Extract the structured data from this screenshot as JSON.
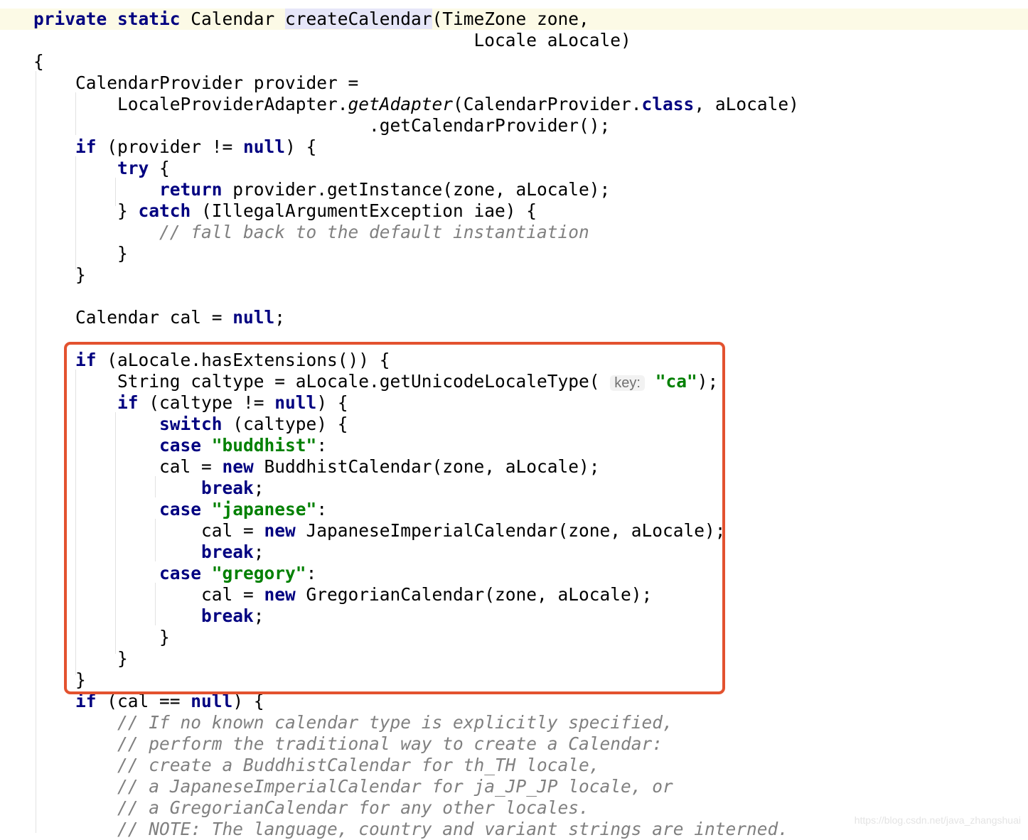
{
  "editor": {
    "language": "java",
    "lines": [
      [
        {
          "t": "private static",
          "c": "kw"
        },
        {
          "t": " Calendar "
        },
        {
          "t": "createCalendar",
          "c": "mhl"
        },
        {
          "t": "(TimeZone zone,"
        }
      ],
      [
        {
          "t": "                                          Locale aLocale)"
        }
      ],
      [
        {
          "t": "{"
        }
      ],
      [
        {
          "t": "    CalendarProvider provider ="
        }
      ],
      [
        {
          "t": "        LocaleProviderAdapter."
        },
        {
          "t": "getAdapter",
          "c": "it"
        },
        {
          "t": "(CalendarProvider."
        },
        {
          "t": "class",
          "c": "kw"
        },
        {
          "t": ", aLocale)"
        }
      ],
      [
        {
          "t": "                                .getCalendarProvider();"
        }
      ],
      [
        {
          "t": "    "
        },
        {
          "t": "if",
          "c": "kw"
        },
        {
          "t": " (provider != "
        },
        {
          "t": "null",
          "c": "kw"
        },
        {
          "t": ") {"
        }
      ],
      [
        {
          "t": "        "
        },
        {
          "t": "try",
          "c": "kw"
        },
        {
          "t": " {"
        }
      ],
      [
        {
          "t": "            "
        },
        {
          "t": "return",
          "c": "kw"
        },
        {
          "t": " provider.getInstance(zone, aLocale);"
        }
      ],
      [
        {
          "t": "        } "
        },
        {
          "t": "catch",
          "c": "kw"
        },
        {
          "t": " (IllegalArgumentException iae) {"
        }
      ],
      [
        {
          "t": "            "
        },
        {
          "t": "// fall back to the default instantiation",
          "c": "cm"
        }
      ],
      [
        {
          "t": "        }"
        }
      ],
      [
        {
          "t": "    }"
        }
      ],
      [
        {
          "t": ""
        }
      ],
      [
        {
          "t": "    Calendar cal = "
        },
        {
          "t": "null",
          "c": "kw"
        },
        {
          "t": ";"
        }
      ],
      [
        {
          "t": ""
        }
      ],
      [
        {
          "t": "    "
        },
        {
          "t": "if",
          "c": "kw"
        },
        {
          "t": " (aLocale.hasExtensions()) {"
        }
      ],
      [
        {
          "t": "        String caltype = aLocale.getUnicodeLocaleType( "
        },
        {
          "t": "key:",
          "c": "hint"
        },
        {
          "t": " "
        },
        {
          "t": "\"ca\"",
          "c": "str"
        },
        {
          "t": ");"
        }
      ],
      [
        {
          "t": "        "
        },
        {
          "t": "if",
          "c": "kw"
        },
        {
          "t": " (caltype != "
        },
        {
          "t": "null",
          "c": "kw"
        },
        {
          "t": ") {"
        }
      ],
      [
        {
          "t": "            "
        },
        {
          "t": "switch",
          "c": "kw"
        },
        {
          "t": " (caltype) {"
        }
      ],
      [
        {
          "t": "            "
        },
        {
          "t": "case",
          "c": "kw"
        },
        {
          "t": " "
        },
        {
          "t": "\"buddhist\"",
          "c": "str"
        },
        {
          "t": ":"
        }
      ],
      [
        {
          "t": "            cal = "
        },
        {
          "t": "new",
          "c": "kw"
        },
        {
          "t": " BuddhistCalendar(zone, aLocale);"
        }
      ],
      [
        {
          "t": "                "
        },
        {
          "t": "break",
          "c": "kw"
        },
        {
          "t": ";"
        }
      ],
      [
        {
          "t": "            "
        },
        {
          "t": "case",
          "c": "kw"
        },
        {
          "t": " "
        },
        {
          "t": "\"japanese\"",
          "c": "str"
        },
        {
          "t": ":"
        }
      ],
      [
        {
          "t": "                cal = "
        },
        {
          "t": "new",
          "c": "kw"
        },
        {
          "t": " JapaneseImperialCalendar(zone, aLocale);"
        }
      ],
      [
        {
          "t": "                "
        },
        {
          "t": "break",
          "c": "kw"
        },
        {
          "t": ";"
        }
      ],
      [
        {
          "t": "            "
        },
        {
          "t": "case",
          "c": "kw"
        },
        {
          "t": " "
        },
        {
          "t": "\"gregory\"",
          "c": "str"
        },
        {
          "t": ":"
        }
      ],
      [
        {
          "t": "                cal = "
        },
        {
          "t": "new",
          "c": "kw"
        },
        {
          "t": " GregorianCalendar(zone, aLocale);"
        }
      ],
      [
        {
          "t": "                "
        },
        {
          "t": "break",
          "c": "kw"
        },
        {
          "t": ";"
        }
      ],
      [
        {
          "t": "            }"
        }
      ],
      [
        {
          "t": "        }"
        }
      ],
      [
        {
          "t": "    }"
        }
      ],
      [
        {
          "t": "    "
        },
        {
          "t": "if",
          "c": "kw"
        },
        {
          "t": " (cal == "
        },
        {
          "t": "null",
          "c": "kw"
        },
        {
          "t": ") {"
        }
      ],
      [
        {
          "t": "        "
        },
        {
          "t": "// If no known calendar type is explicitly specified,",
          "c": "cm"
        }
      ],
      [
        {
          "t": "        "
        },
        {
          "t": "// perform the traditional way to create a Calendar:",
          "c": "cm"
        }
      ],
      [
        {
          "t": "        "
        },
        {
          "t": "// create a BuddhistCalendar for th_TH locale,",
          "c": "cm"
        }
      ],
      [
        {
          "t": "        "
        },
        {
          "t": "// a JapaneseImperialCalendar for ja_JP_JP locale, or",
          "c": "cm"
        }
      ],
      [
        {
          "t": "        "
        },
        {
          "t": "// a GregorianCalendar for any other locales.",
          "c": "cm"
        }
      ],
      [
        {
          "t": "        "
        },
        {
          "t": "// NOTE: The language, country and variant strings are interned.",
          "c": "cm"
        }
      ]
    ]
  },
  "watermark": "https://blog.csdn.net/java_zhangshuai",
  "colors": {
    "keyword": "#000080",
    "string": "#008000",
    "comment": "#808080",
    "highlight_box": "#e3522f",
    "current_line": "#fcfae6"
  }
}
